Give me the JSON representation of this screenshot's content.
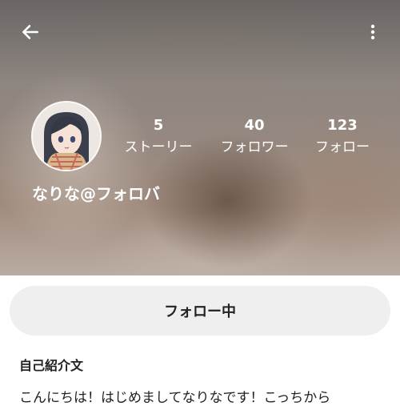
{
  "header": {
    "back_icon": "arrow-left-icon",
    "more_icon": "more-vertical-icon"
  },
  "profile": {
    "avatar_icon": "avatar-anime-girl",
    "username": "なりな@フォロバ",
    "stats": [
      {
        "count": "5",
        "label": "ストーリー"
      },
      {
        "count": "40",
        "label": "フォロワー"
      },
      {
        "count": "123",
        "label": "フォロー"
      }
    ]
  },
  "actions": {
    "follow_label": "フォロー中"
  },
  "bio": {
    "heading": "自己紹介文",
    "text": "こんにちは！はじめましてなりなです！こっちから"
  },
  "colors": {
    "button_bg": "#efeff0",
    "text": "#222222",
    "overlay_text": "#ffffff"
  }
}
